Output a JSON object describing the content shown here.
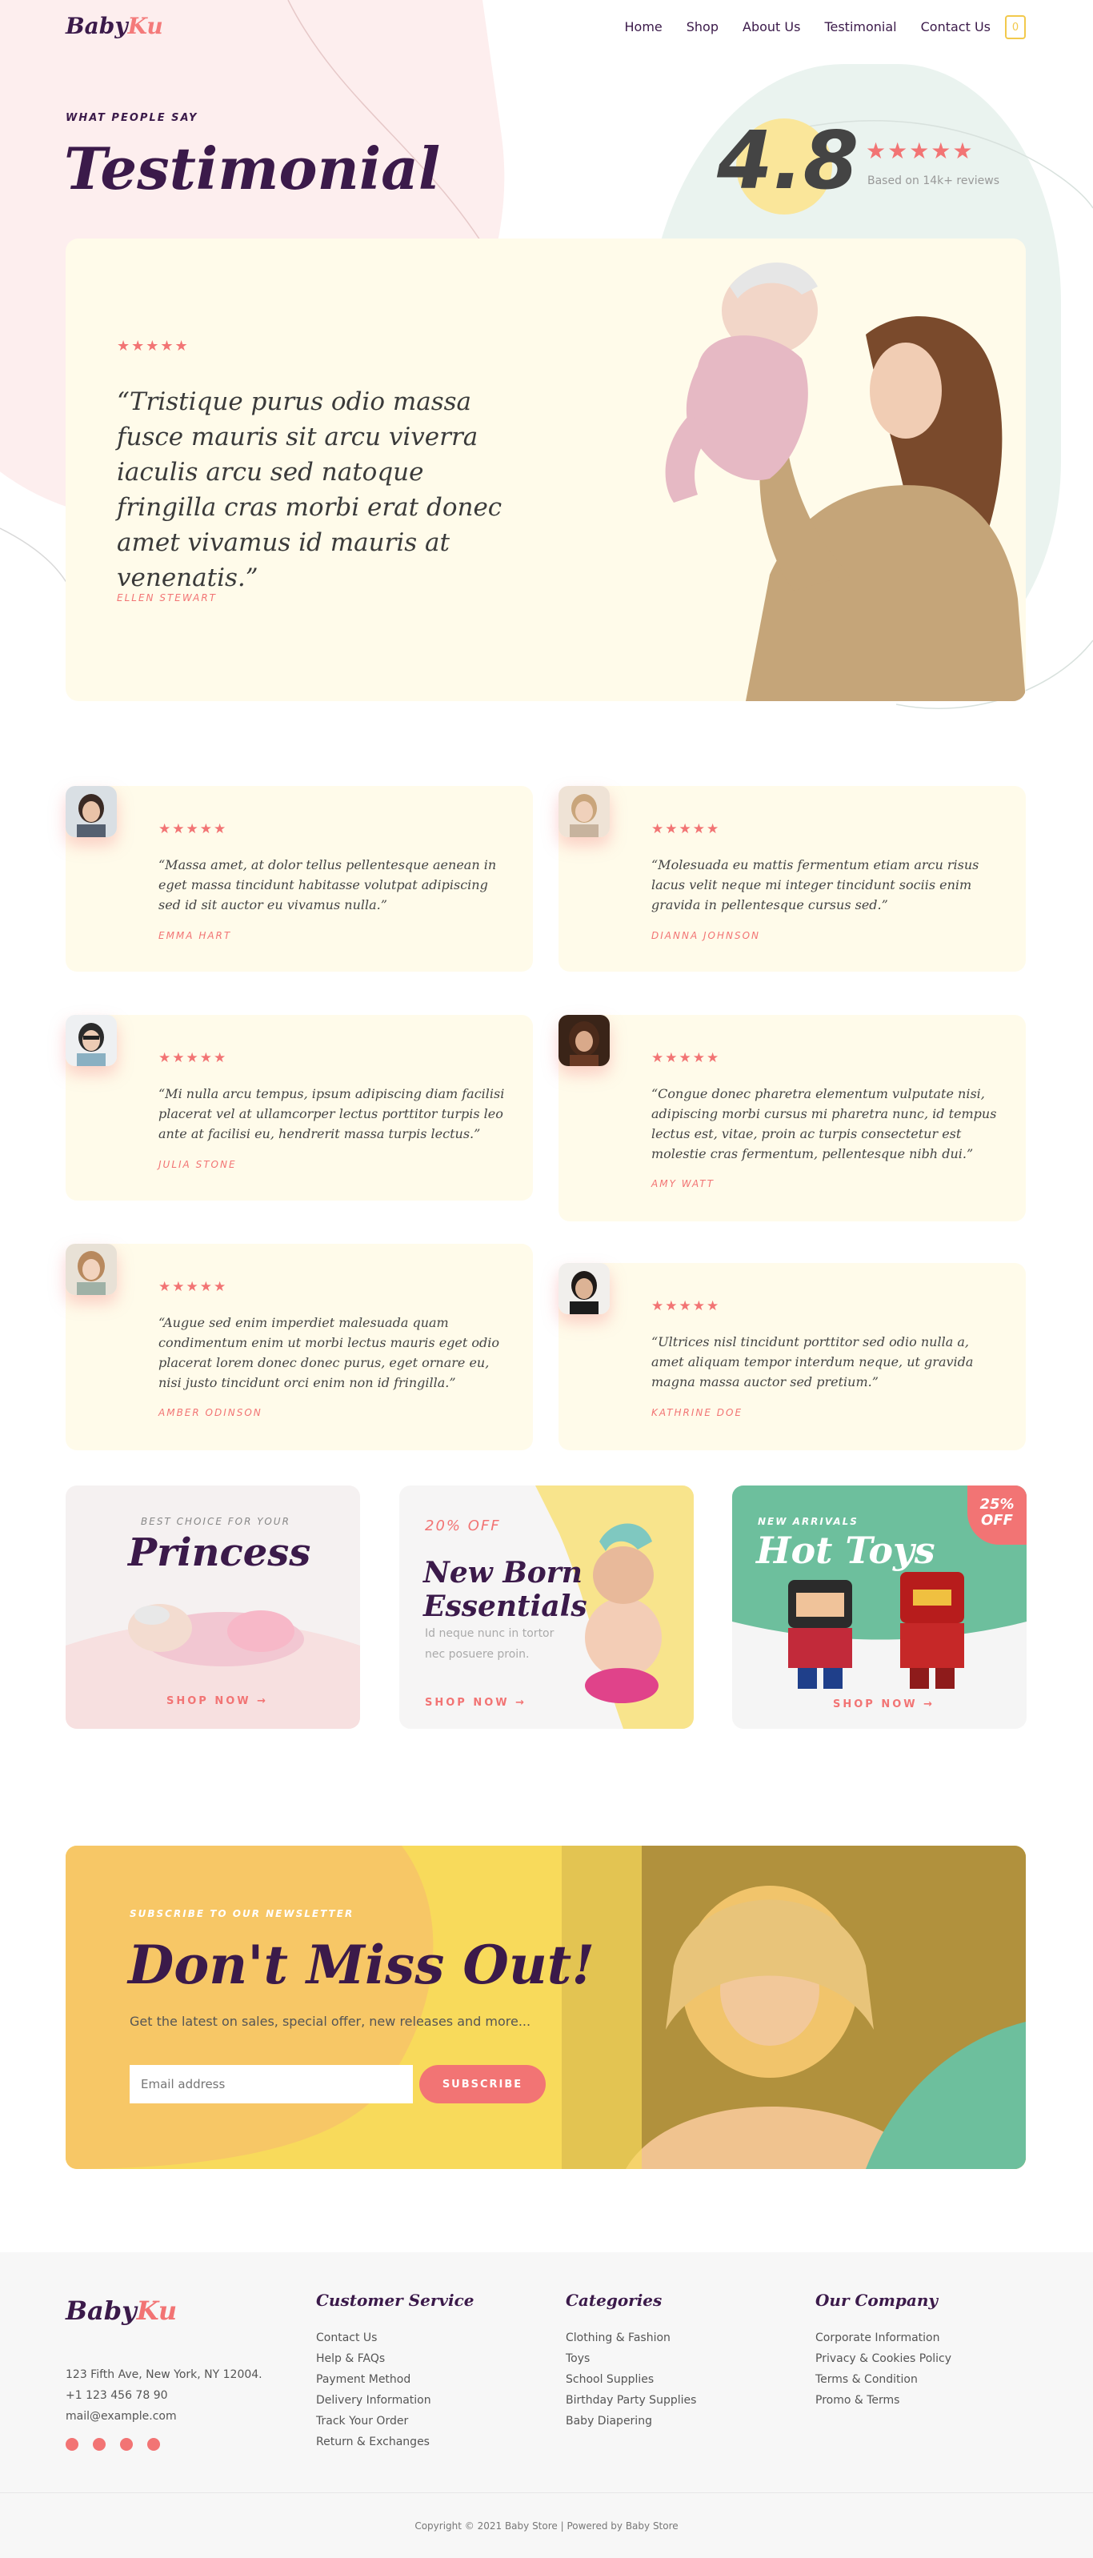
{
  "header": {
    "logo_a": "Baby",
    "logo_b": "Ku",
    "nav": [
      "Home",
      "Shop",
      "About Us",
      "Testimonial",
      "Contact Us"
    ],
    "cart_count": "0"
  },
  "hero": {
    "kicker": "WHAT PEOPLE SAY",
    "title": "Testimonial",
    "rating": "4.8",
    "stars": "★★★★★",
    "rating_sub": "Based on 14k+ reviews",
    "quote": "“Tristique purus odio massa fusce mauris sit arcu viverra iaculis arcu sed natoque fringilla cras morbi erat donec amet vivamus id mauris at venenatis.”",
    "author": "ELLEN STEWART"
  },
  "reviews": [
    {
      "stars": "★★★★★",
      "quote": "“Massa amet, at dolor tellus pellentesque aenean in eget massa tincidunt habitasse volutpat adipiscing sed id sit auctor eu vivamus nulla.”",
      "name": "EMMA HART"
    },
    {
      "stars": "★★★★★",
      "quote": "“Molesuada eu mattis fermentum etiam arcu risus lacus velit neque mi integer tincidunt sociis enim gravida in pellentesque cursus sed.”",
      "name": "DIANNA JOHNSON"
    },
    {
      "stars": "★★★★★",
      "quote": "“Mi nulla arcu tempus, ipsum adipiscing diam facilisi placerat vel at ullamcorper lectus porttitor turpis leo ante at facilisi eu, hendrerit massa turpis lectus.”",
      "name": "JULIA STONE"
    },
    {
      "stars": "★★★★★",
      "quote": "“Congue donec pharetra elementum vulputate nisi, adipiscing morbi cursus mi pharetra nunc, id tempus lectus est, vitae, proin ac turpis consectetur est molestie cras fermentum, pellentesque nibh dui.”",
      "name": "AMY WATT"
    },
    {
      "stars": "★★★★★",
      "quote": "“Augue sed enim imperdiet malesuada quam condimentum enim ut morbi lectus mauris eget odio placerat lorem donec donec purus, eget ornare eu, nisi justo tincidunt orci enim non id fringilla.”",
      "name": "AMBER ODINSON"
    },
    {
      "stars": "★★★★★",
      "quote": "“Ultrices nisl tincidunt porttitor sed odio nulla a, amet aliquam tempor interdum neque, ut gravida magna massa auctor sed pretium.”",
      "name": "KATHRINE DOE"
    }
  ],
  "promos": {
    "p1_kicker": "BEST CHOICE FOR YOUR",
    "p1_title": "Princess",
    "p1_shop": "SHOP NOW →",
    "p2_off": "20% OFF",
    "p2_title_1": "New Born",
    "p2_title_2": "Essentials",
    "p2_desc_1": "Id neque nunc in tortor",
    "p2_desc_2": "nec posuere proin.",
    "p2_shop": "SHOP NOW →",
    "p3_kicker": "NEW ARRIVALS",
    "p3_title": "Hot Toys",
    "p3_badge_1": "25%",
    "p3_badge_2": "OFF",
    "p3_shop": "SHOP NOW →"
  },
  "newsletter": {
    "kicker": "SUBSCRIBE TO OUR NEWSLETTER",
    "title": "Don't Miss Out!",
    "subtitle": "Get the latest on sales, special offer, new releases and more...",
    "placeholder": "Email address",
    "button": "SUBSCRIBE"
  },
  "footer": {
    "logo_a": "Baby",
    "logo_b": "Ku",
    "address": "123 Fifth Ave, New York, NY 12004.",
    "phone": "+1 123 456 78 90",
    "email": "mail@example.com",
    "col1_title": "Customer Service",
    "col1": [
      "Contact Us",
      "Help & FAQs",
      "Payment Method",
      "Delivery Information",
      "Track Your Order",
      "Return & Exchanges"
    ],
    "col2_title": "Categories",
    "col2": [
      "Clothing & Fashion",
      "Toys",
      "School Supplies",
      "Birthday Party Supplies",
      "Baby Diapering"
    ],
    "col3_title": "Our Company",
    "col3": [
      "Corporate Information",
      "Privacy & Cookies Policy",
      "Terms & Condition",
      "Promo & Terms"
    ],
    "copyright": "Copyright © 2021 Baby Store | Powered by Baby Store"
  },
  "colors": {
    "brand_dark": "#3b1a4a",
    "accent_pink": "#f27474",
    "card_cream": "#fffbea",
    "newsletter_yellow": "#f8da5b",
    "toys_green": "#6dbf9d"
  }
}
